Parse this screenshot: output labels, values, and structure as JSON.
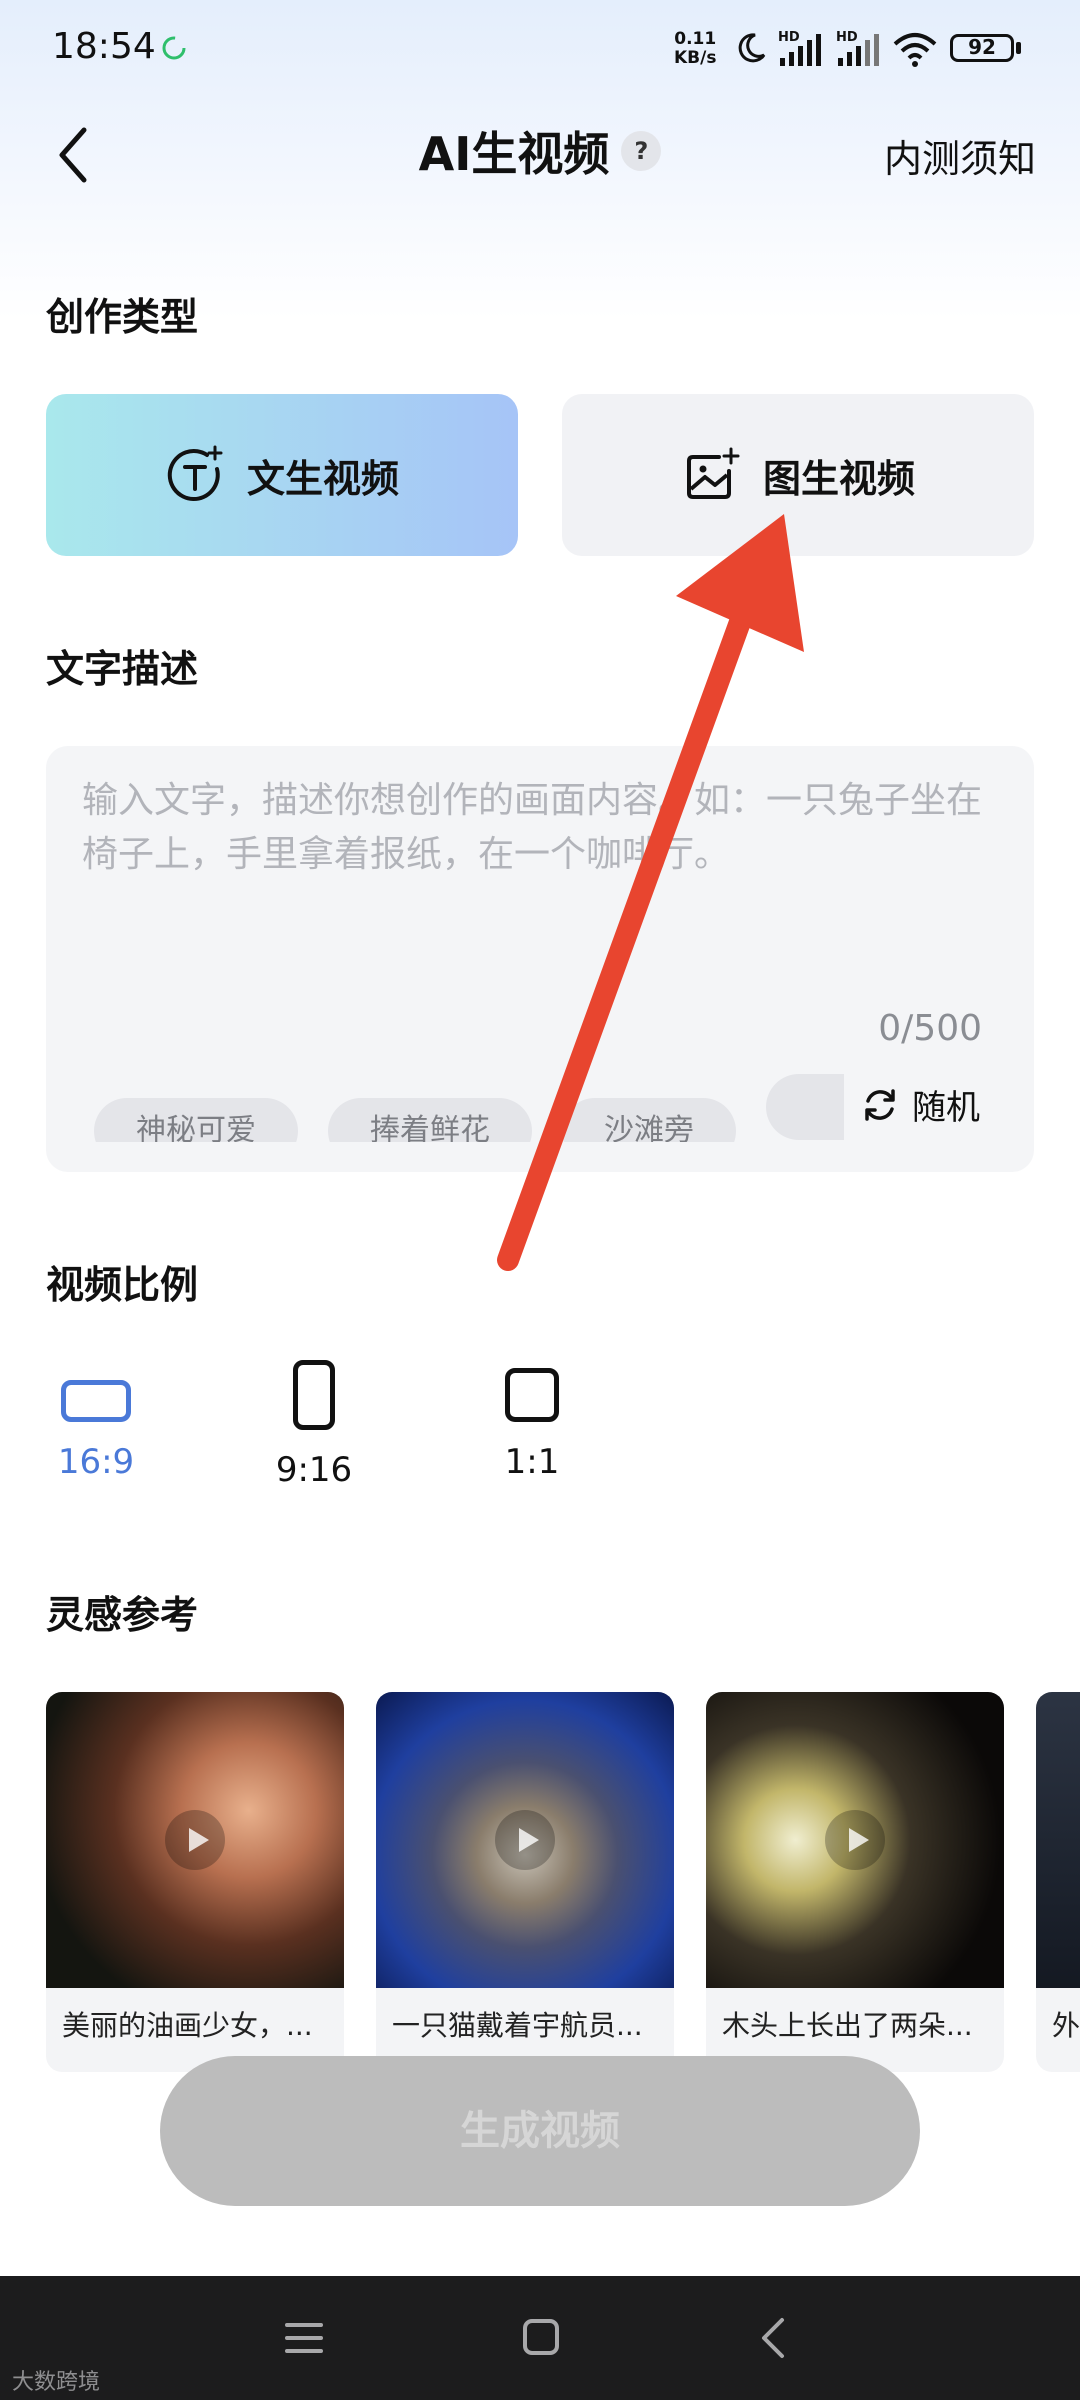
{
  "status_bar": {
    "time": "18:54",
    "net_speed_value": "0.11",
    "net_speed_unit": "KB/s",
    "hd_label": "HD",
    "battery": "92"
  },
  "header": {
    "title": "AI生视频",
    "help": "?",
    "beta_notice": "内测须知"
  },
  "creation_type": {
    "title": "创作类型",
    "options": [
      {
        "label": "文生视频",
        "icon": "text-to-video-icon",
        "selected": true
      },
      {
        "label": "图生视频",
        "icon": "image-to-video-icon",
        "selected": false
      }
    ]
  },
  "text_desc": {
    "title": "文字描述",
    "placeholder": "输入文字，描述你想创作的画面内容。如：一只兔子坐在椅子上，手里拿着报纸，在一个咖啡厅。",
    "count": "0/500",
    "chips": [
      "神秘可爱",
      "捧着鲜花",
      "沙滩旁",
      ""
    ],
    "random_label": "随机"
  },
  "ratio": {
    "title": "视频比例",
    "options": [
      {
        "label": "16:9",
        "selected": true
      },
      {
        "label": "9:16",
        "selected": false
      },
      {
        "label": "1:1",
        "selected": false
      }
    ]
  },
  "inspiration": {
    "title": "灵感参考",
    "items": [
      {
        "caption": "美丽的油画少女，..."
      },
      {
        "caption": "一只猫戴着宇航员..."
      },
      {
        "caption": "木头上长出了两朵..."
      },
      {
        "caption": "外"
      }
    ]
  },
  "generate_label": "生成视频",
  "watermark": "大数跨境",
  "colors": {
    "accent_blue": "#4a79d8",
    "annotation_arrow": "#e8452f",
    "selected_gradient_start": "#a9e8ec",
    "selected_gradient_end": "#a6c4f7"
  }
}
